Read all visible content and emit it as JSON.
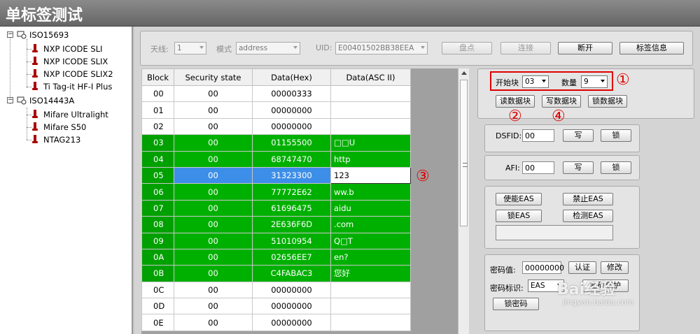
{
  "window": {
    "title": "单标签测试"
  },
  "tree": {
    "roots": [
      {
        "label": "ISO15693",
        "toggle": "−",
        "children": [
          "NXP ICODE SLI",
          "NXP ICODE SLIX",
          "NXP ICODE SLIX2",
          "Ti Tag-it HF-I Plus"
        ]
      },
      {
        "label": "ISO14443A",
        "toggle": "−",
        "children": [
          "Mifare Ultralight",
          "Mifare S50",
          "NTAG213"
        ]
      }
    ]
  },
  "toolbar": {
    "antenna_label": "天线:",
    "antenna_value": "1",
    "mode_label": "模式",
    "mode_value": "address",
    "uid_label": "UID:",
    "uid_value": "E00401502BB38EEA",
    "inventory_button": "盘点",
    "connect_button": "连接",
    "disconnect_button": "断开",
    "tag_info_button": "标签信息"
  },
  "grid": {
    "headers": [
      "Block",
      "Security state",
      "Data(Hex)",
      "Data(ASC II)"
    ],
    "rows": [
      {
        "block": "00",
        "state": "00",
        "hex": "00000333",
        "asc": ""
      },
      {
        "block": "01",
        "state": "00",
        "hex": "00000000",
        "asc": ""
      },
      {
        "block": "02",
        "state": "00",
        "hex": "00000000",
        "asc": ""
      },
      {
        "block": "03",
        "state": "00",
        "hex": "01155500",
        "asc": "□□U"
      },
      {
        "block": "04",
        "state": "00",
        "hex": "68747470",
        "asc": "http"
      },
      {
        "block": "05",
        "state": "00",
        "hex": "31323300",
        "asc": "123"
      },
      {
        "block": "06",
        "state": "00",
        "hex": "77772E62",
        "asc": "ww.b"
      },
      {
        "block": "07",
        "state": "00",
        "hex": "61696475",
        "asc": "aidu"
      },
      {
        "block": "08",
        "state": "00",
        "hex": "2E636F6D",
        "asc": ".com"
      },
      {
        "block": "09",
        "state": "00",
        "hex": "51010954",
        "asc": "Q□T"
      },
      {
        "block": "0A",
        "state": "00",
        "hex": "02656EE7",
        "asc": " en?"
      },
      {
        "block": "0B",
        "state": "00",
        "hex": "C4FABAC3",
        "asc": "您好"
      },
      {
        "block": "0C",
        "state": "00",
        "hex": "00000000",
        "asc": ""
      },
      {
        "block": "0D",
        "state": "00",
        "hex": "00000000",
        "asc": ""
      },
      {
        "block": "0E",
        "state": "00",
        "hex": "00000000",
        "asc": ""
      }
    ]
  },
  "annotations": [
    "①",
    "②",
    "③",
    "④"
  ],
  "blocks_panel": {
    "start_label": "开始块",
    "start_value": "03",
    "count_label": "数量",
    "count_value": "9",
    "read_button": "读数据块",
    "write_button": "写数据块",
    "lock_button": "锁数据块"
  },
  "dsfid": {
    "label": "DSFID:",
    "value": "00",
    "write_button": "写",
    "lock_button": "锁"
  },
  "afi": {
    "label": "AFI:",
    "value": "00",
    "write_button": "写",
    "lock_button": "锁"
  },
  "eas": {
    "enable_button": "使能EAS",
    "disable_button": "禁止EAS",
    "lock_button": "锁EAS",
    "detect_button": "检测EAS"
  },
  "password": {
    "value_label": "密码值:",
    "value": "00000000",
    "auth_button": "认证",
    "modify_button": "修改",
    "id_label": "密码标识:",
    "id_value": "EAS",
    "protect_button": "密码保护",
    "lock_button": "锁密码"
  },
  "watermark": {
    "logo": "Bai经验",
    "url": "jingyan.baidu.com"
  }
}
